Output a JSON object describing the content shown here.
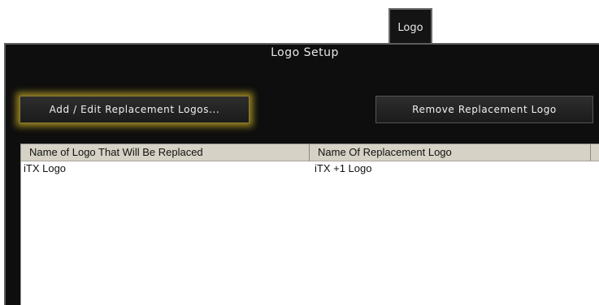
{
  "tab": {
    "label": "Logo"
  },
  "panel": {
    "title": "Logo Setup",
    "add_button_label": "Add / Edit Replacement Logos...",
    "remove_button_label": "Remove Replacement Logo",
    "accent_color": "#c4aa28"
  },
  "table": {
    "columns": [
      "Name of Logo That Will Be Replaced",
      "Name Of Replacement Logo"
    ],
    "rows": [
      {
        "original": "iTX Logo",
        "replacement": "iTX +1 Logo"
      }
    ]
  }
}
